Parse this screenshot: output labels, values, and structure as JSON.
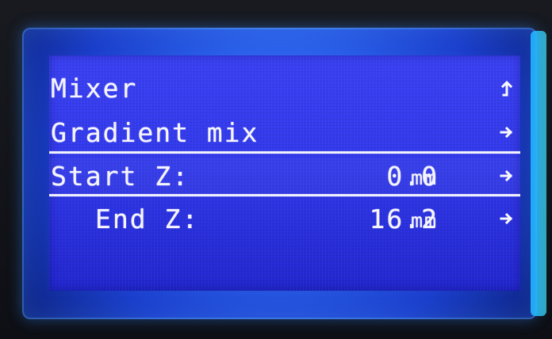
{
  "screen": {
    "rows": [
      {
        "label": "Mixer",
        "value": "",
        "unit": "",
        "icon": "up-return-icon"
      },
      {
        "label": "Gradient mix",
        "value": "",
        "unit": "",
        "icon": "right-arrow-icon"
      },
      {
        "label": "Start Z:",
        "value": "0.0",
        "unit": "mm",
        "icon": "right-arrow-icon"
      },
      {
        "label": "End Z:",
        "value": "16.2",
        "unit": "mm",
        "icon": "right-arrow-icon"
      }
    ]
  },
  "colors": {
    "screen_blue": "#2f36f2",
    "text_white": "#f5f4ff",
    "backlight_cyan": "#43e5ff"
  }
}
